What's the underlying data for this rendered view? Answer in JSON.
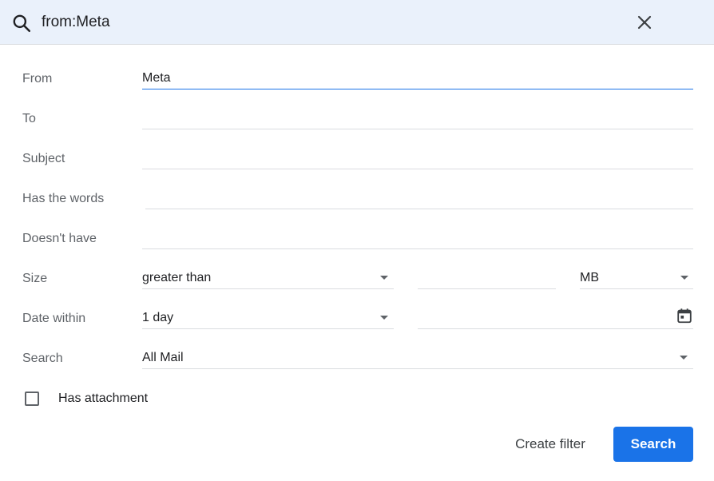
{
  "search": {
    "query": "from:Meta",
    "search_icon": "search-icon",
    "close_icon": "close-icon"
  },
  "form": {
    "from": {
      "label": "From",
      "value": "Meta"
    },
    "to": {
      "label": "To",
      "value": ""
    },
    "subject": {
      "label": "Subject",
      "value": ""
    },
    "has_words": {
      "label": "Has the words",
      "value": ""
    },
    "doesnt_have": {
      "label": "Doesn't have",
      "value": ""
    },
    "size": {
      "label": "Size",
      "operator": "greater than",
      "value": "",
      "unit": "MB"
    },
    "date_within": {
      "label": "Date within",
      "value": "1 day",
      "date": ""
    },
    "search_in": {
      "label": "Search",
      "value": "All Mail"
    },
    "has_attachment": {
      "label": "Has attachment",
      "checked": false
    }
  },
  "actions": {
    "create_filter": "Create filter",
    "search": "Search"
  },
  "colors": {
    "accent": "#1a73e8",
    "topbar_bg": "#eaf1fb",
    "label": "#5f6368"
  }
}
